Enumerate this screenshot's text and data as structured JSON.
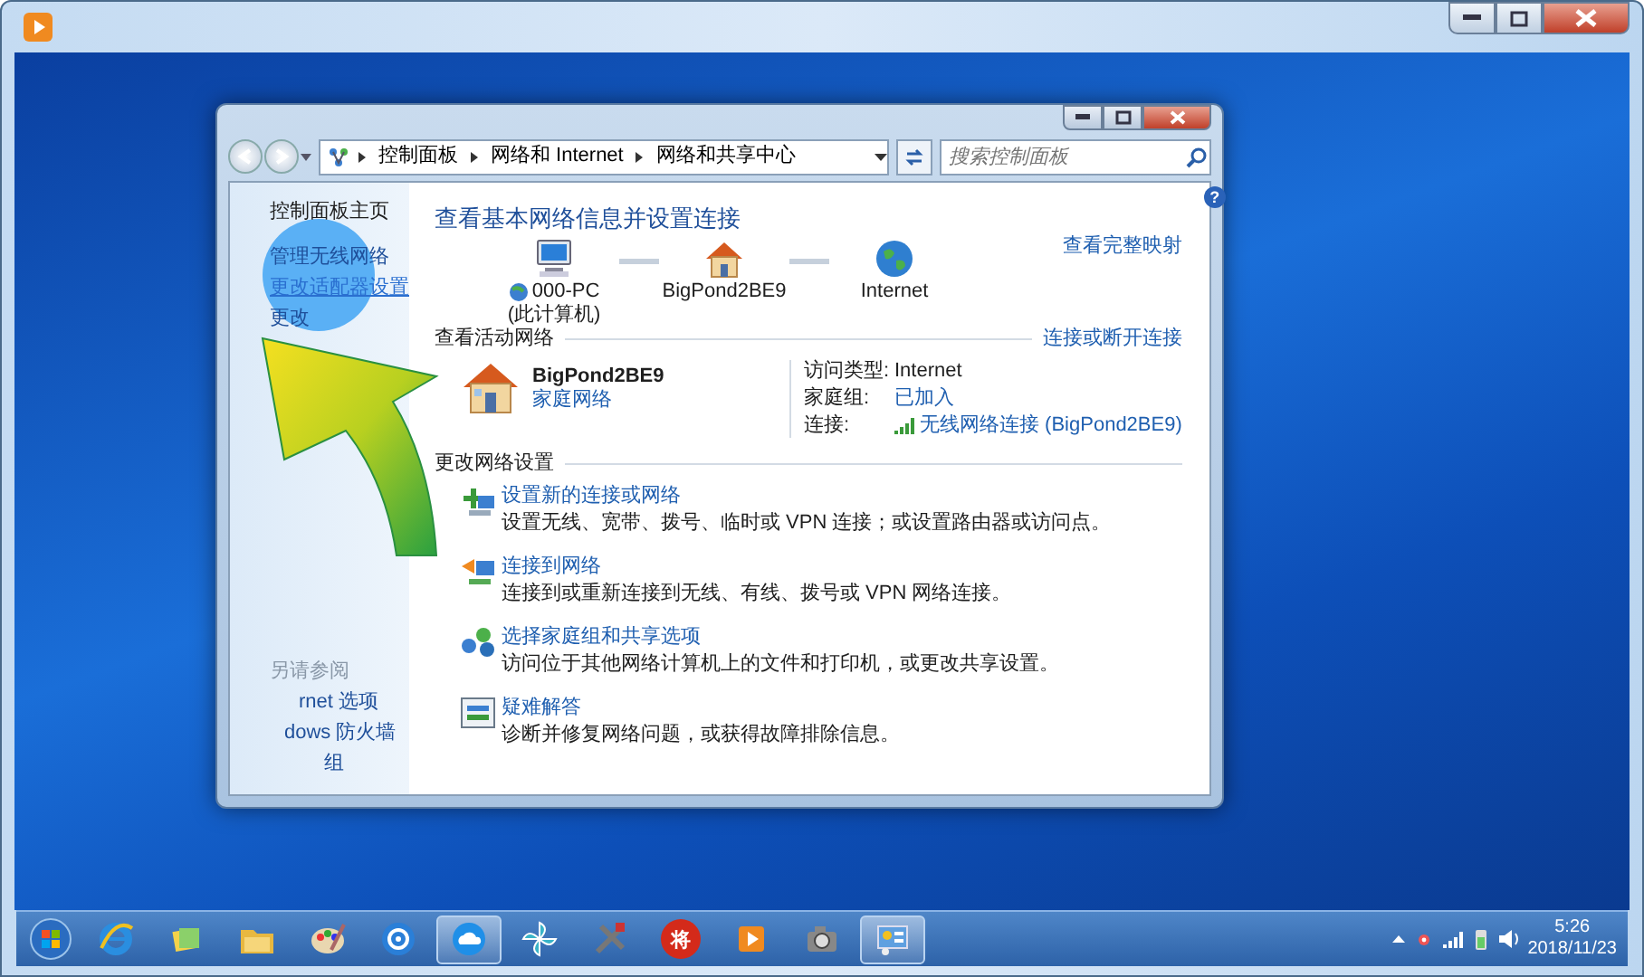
{
  "window": {
    "help": "?",
    "breadcrumb": [
      "控制面板",
      "网络和 Internet",
      "网络和共享中心"
    ],
    "search": {
      "placeholder": "搜索控制面板"
    }
  },
  "sidebar": {
    "home": "控制面板主页",
    "links": [
      {
        "label": "管理无线网络",
        "selected": false
      },
      {
        "label": "更改适配器设置",
        "selected": true
      },
      {
        "label": "更改",
        "selected": false
      }
    ],
    "see_also_title": "另请参阅",
    "see_also": [
      "rnet 选项",
      "dows 防火墙",
      "组"
    ]
  },
  "main": {
    "title": "查看基本网络信息并设置连接",
    "map_link": "查看完整映射",
    "nodes": [
      {
        "kind": "computer",
        "label": "000-PC",
        "sublabel": "(此计算机)"
      },
      {
        "kind": "house",
        "label": "BigPond2BE9"
      },
      {
        "kind": "globe",
        "label": "Internet"
      }
    ],
    "active": {
      "heading": "查看活动网络",
      "link": "连接或断开连接",
      "name": "BigPond2BE9",
      "type": "家庭网络",
      "props": [
        {
          "kind": "text",
          "label": "访问类型:",
          "value": "Internet"
        },
        {
          "kind": "link",
          "label": "家庭组:",
          "value": "已加入"
        },
        {
          "kind": "wifi",
          "label": "连接:",
          "value": "无线网络连接 (BigPond2BE9)"
        }
      ]
    },
    "change": {
      "heading": "更改网络设置",
      "tasks": [
        {
          "kind": "new",
          "title": "设置新的连接或网络",
          "desc": "设置无线、宽带、拨号、临时或 VPN 连接；或设置路由器或访问点。"
        },
        {
          "kind": "connect",
          "title": "连接到网络",
          "desc": "连接到或重新连接到无线、有线、拨号或 VPN 网络连接。"
        },
        {
          "kind": "share",
          "title": "选择家庭组和共享选项",
          "desc": "访问位于其他网络计算机上的文件和打印机，或更改共享设置。"
        },
        {
          "kind": "trouble",
          "title": "疑难解答",
          "desc": "诊断并修复网络问题，或获得故障排除信息。"
        }
      ]
    }
  },
  "taskbar": {
    "apps": [
      {
        "kind": "ie",
        "selected": false
      },
      {
        "kind": "notes",
        "selected": false
      },
      {
        "kind": "folder",
        "selected": false
      },
      {
        "kind": "paint",
        "selected": false
      },
      {
        "kind": "video",
        "selected": false
      },
      {
        "kind": "cloud",
        "selected": true
      },
      {
        "kind": "pinwheel",
        "selected": false
      },
      {
        "kind": "tools",
        "selected": false
      },
      {
        "kind": "chess",
        "selected": false,
        "text": "将"
      },
      {
        "kind": "player",
        "selected": false
      },
      {
        "kind": "camera",
        "selected": false
      },
      {
        "kind": "netpanel",
        "selected": true
      }
    ],
    "clock": {
      "time": "5:26",
      "date": "2018/11/23"
    }
  }
}
